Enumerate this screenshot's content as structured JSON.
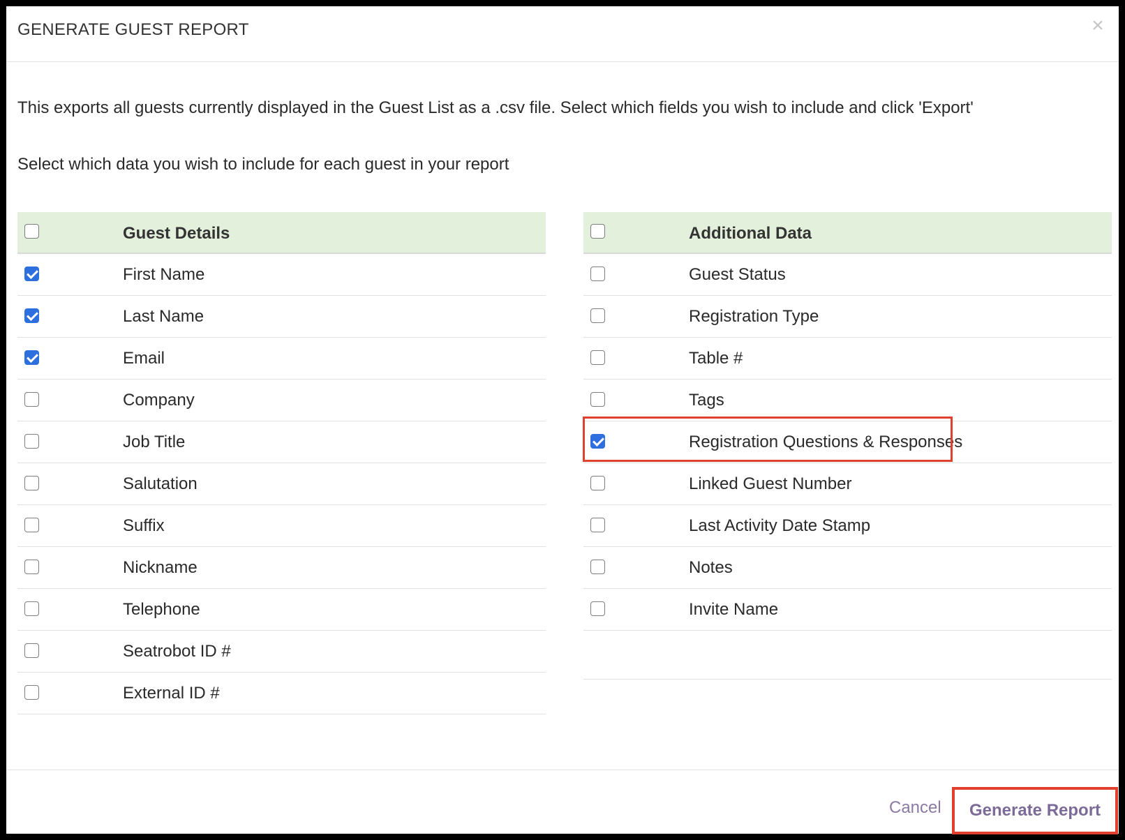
{
  "modal": {
    "title": "GENERATE GUEST REPORT",
    "close_icon": "×",
    "intro": "This exports all guests currently displayed in the Guest List as a .csv file. Select which fields you wish to include and click 'Export'",
    "subintro": "Select which data you wish to include for each guest in your report"
  },
  "guest_details": {
    "header": "Guest Details",
    "header_checked": false,
    "items": [
      {
        "label": "First Name",
        "checked": true
      },
      {
        "label": "Last Name",
        "checked": true
      },
      {
        "label": "Email",
        "checked": true
      },
      {
        "label": "Company",
        "checked": false
      },
      {
        "label": "Job Title",
        "checked": false
      },
      {
        "label": "Salutation",
        "checked": false
      },
      {
        "label": "Suffix",
        "checked": false
      },
      {
        "label": "Nickname",
        "checked": false
      },
      {
        "label": "Telephone",
        "checked": false
      },
      {
        "label": "Seatrobot ID #",
        "checked": false
      },
      {
        "label": "External ID #",
        "checked": false
      }
    ]
  },
  "additional_data": {
    "header": "Additional Data",
    "header_checked": false,
    "items": [
      {
        "label": "Guest Status",
        "checked": false
      },
      {
        "label": "Registration Type",
        "checked": false
      },
      {
        "label": "Table #",
        "checked": false
      },
      {
        "label": "Tags",
        "checked": false
      },
      {
        "label": "Registration Questions & Responses",
        "checked": true
      },
      {
        "label": "Linked Guest Number",
        "checked": false
      },
      {
        "label": "Last Activity Date Stamp",
        "checked": false
      },
      {
        "label": "Notes",
        "checked": false
      },
      {
        "label": "Invite Name",
        "checked": false
      }
    ]
  },
  "footer": {
    "cancel_label": "Cancel",
    "generate_label": "Generate Report"
  },
  "colors": {
    "accent_check": "#2d6fde",
    "header_bg": "#e2f0dc",
    "highlight": "#e0412f",
    "button_text": "#7c6a98"
  }
}
